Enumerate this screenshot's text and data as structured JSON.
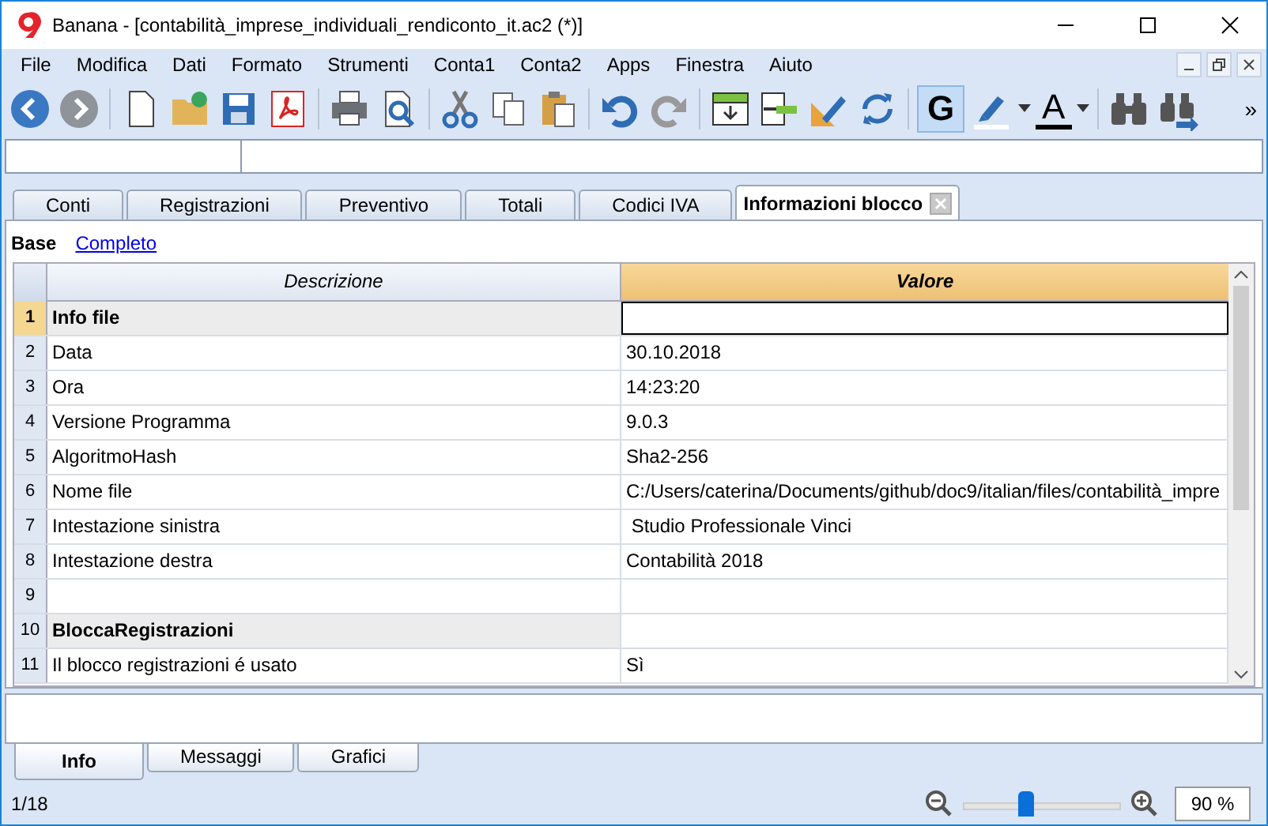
{
  "window": {
    "title": "Banana - [contabilità_imprese_individuali_rendiconto_it.ac2 (*)]"
  },
  "menu": [
    "File",
    "Modifica",
    "Dati",
    "Formato",
    "Strumenti",
    "Conta1",
    "Conta2",
    "Apps",
    "Finestra",
    "Aiuto"
  ],
  "toolbar": {
    "bold_label": "G",
    "bold_selected": true,
    "font_color_label": "A",
    "overflow": "»"
  },
  "tabs": [
    {
      "label": "Conti",
      "selected": false
    },
    {
      "label": "Registrazioni",
      "selected": false
    },
    {
      "label": "Preventivo",
      "selected": false
    },
    {
      "label": "Totali",
      "selected": false
    },
    {
      "label": "Codici IVA",
      "selected": false
    },
    {
      "label": "Informazioni blocco",
      "selected": true
    }
  ],
  "views": [
    {
      "label": "Base",
      "selected": true
    },
    {
      "label": "Completo",
      "selected": false
    }
  ],
  "table": {
    "columns": [
      "Descrizione",
      "Valore"
    ],
    "rows": [
      {
        "number": "1",
        "description": "Info file",
        "value": "",
        "kind": "section",
        "selected": true
      },
      {
        "number": "2",
        "description": "Data",
        "value": "30.10.2018",
        "kind": "item",
        "selected": false
      },
      {
        "number": "3",
        "description": "Ora",
        "value": "14:23:20",
        "kind": "item",
        "selected": false
      },
      {
        "number": "4",
        "description": "Versione Programma",
        "value": "9.0.3",
        "kind": "item",
        "selected": false
      },
      {
        "number": "5",
        "description": "AlgoritmoHash",
        "value": "Sha2-256",
        "kind": "item",
        "selected": false
      },
      {
        "number": "6",
        "description": "Nome file",
        "value": "C:/Users/caterina/Documents/github/doc9/italian/files/contabilità_impre",
        "kind": "item",
        "selected": false
      },
      {
        "number": "7",
        "description": "Intestazione sinistra",
        "value": " Studio Professionale Vinci",
        "kind": "item",
        "selected": false
      },
      {
        "number": "8",
        "description": "Intestazione destra",
        "value": "Contabilità 2018",
        "kind": "item",
        "selected": false
      },
      {
        "number": "9",
        "description": "",
        "value": "",
        "kind": "item",
        "selected": false
      },
      {
        "number": "10",
        "description": "BloccaRegistrazioni",
        "value": "",
        "kind": "section",
        "selected": false
      },
      {
        "number": "11",
        "description": "Il blocco registrazioni é usato",
        "value": "Sì",
        "kind": "item",
        "selected": false
      }
    ]
  },
  "info_tabs": [
    {
      "label": "Info",
      "selected": true
    },
    {
      "label": "Messaggi",
      "selected": false
    },
    {
      "label": "Grafici",
      "selected": false
    }
  ],
  "status_bar": {
    "page": "1/18",
    "zoom": {
      "level": 0.4,
      "value": "90 %"
    }
  }
}
